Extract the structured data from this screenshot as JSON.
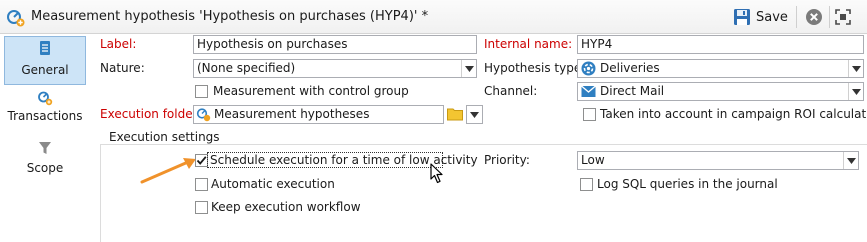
{
  "window": {
    "title": "Measurement hypothesis 'Hypothesis on purchases (HYP4)' *",
    "save_label": "Save"
  },
  "nav": {
    "items": [
      {
        "label": "General",
        "selected": true
      },
      {
        "label": "Transactions",
        "selected": false
      },
      {
        "label": "Scope",
        "selected": false
      }
    ]
  },
  "form": {
    "label_label": "Label:",
    "label_value": "Hypothesis on purchases",
    "internal_name_label": "Internal name:",
    "internal_name_value": "HYP4",
    "nature_label": "Nature:",
    "nature_value": "(None specified)",
    "hypothesis_type_label": "Hypothesis type:",
    "hypothesis_type_value": "Deliveries",
    "measurement_control_label": "Measurement with control group",
    "measurement_control_checked": false,
    "channel_label": "Channel:",
    "channel_value": "Direct Mail",
    "execution_folder_label": "Execution folder:",
    "execution_folder_value": "Measurement hypotheses",
    "roi_label": "Taken into account in campaign ROI calculation",
    "roi_checked": false
  },
  "execution_settings": {
    "group_title": "Execution settings",
    "schedule_low_label": "Schedule execution for a time of low activity",
    "schedule_low_checked": true,
    "automatic_label": "Automatic execution",
    "automatic_checked": false,
    "keep_workflow_label": "Keep execution workflow",
    "keep_workflow_checked": false,
    "priority_label": "Priority:",
    "priority_value": "Low",
    "log_sql_label": "Log SQL queries in the journal",
    "log_sql_checked": false
  },
  "colors": {
    "accent": "#2f7fc1",
    "required_label": "#cc0000",
    "selected_nav_bg": "#cde4f7",
    "annotation_arrow": "#f0922b"
  }
}
